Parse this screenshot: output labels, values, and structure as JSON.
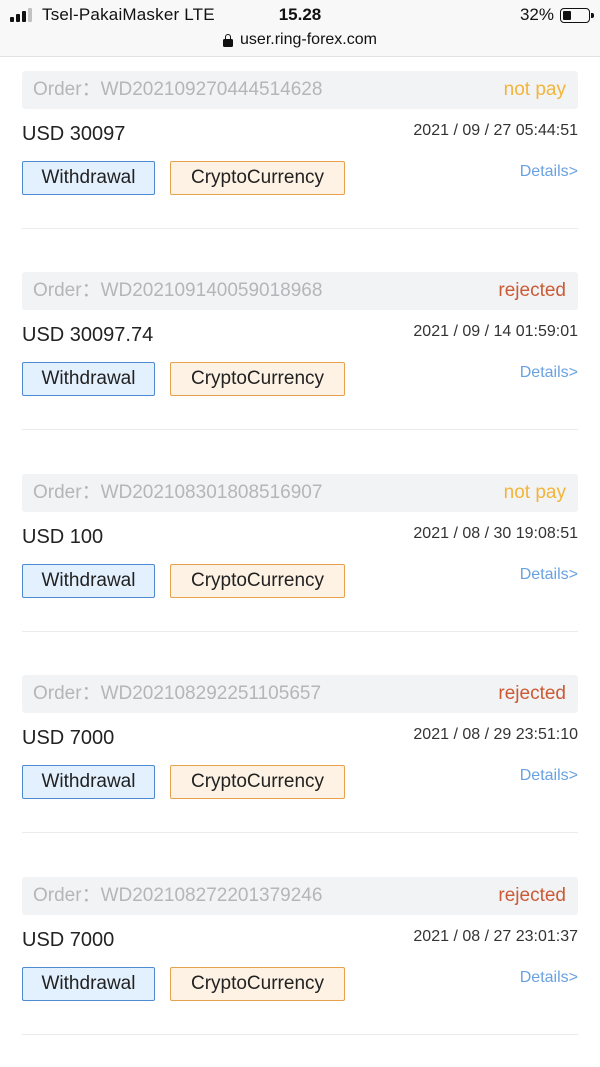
{
  "status_bar": {
    "carrier": "Tsel-PakaiMasker  LTE",
    "time": "15.28",
    "battery": "32%"
  },
  "browser": {
    "url": "user.ring-forex.com"
  },
  "colors": {
    "not_pay": "#f2b53a",
    "rejected": "#cc5a35",
    "link": "#6aa2e0"
  },
  "orders": [
    {
      "label": "Order：WD202109270444514628",
      "status": "not pay",
      "status_key": "not_pay",
      "amount": "USD 30097",
      "datetime": "2021 / 09 / 27 05:44:51",
      "type": "Withdrawal",
      "method": "CryptoCurrency",
      "details": "Details>"
    },
    {
      "label": "Order：WD202109140059018968",
      "status": "rejected",
      "status_key": "rejected",
      "amount": "USD 30097.74",
      "datetime": "2021 / 09 / 14 01:59:01",
      "type": "Withdrawal",
      "method": "CryptoCurrency",
      "details": "Details>"
    },
    {
      "label": "Order：WD202108301808516907",
      "status": "not pay",
      "status_key": "not_pay",
      "amount": "USD 100",
      "datetime": "2021 / 08 / 30 19:08:51",
      "type": "Withdrawal",
      "method": "CryptoCurrency",
      "details": "Details>"
    },
    {
      "label": "Order：WD202108292251105657",
      "status": "rejected",
      "status_key": "rejected",
      "amount": "USD 7000",
      "datetime": "2021 / 08 / 29 23:51:10",
      "type": "Withdrawal",
      "method": "CryptoCurrency",
      "details": "Details>"
    },
    {
      "label": "Order：WD202108272201379246",
      "status": "rejected",
      "status_key": "rejected",
      "amount": "USD 7000",
      "datetime": "2021 / 08 / 27 23:01:37",
      "type": "Withdrawal",
      "method": "CryptoCurrency",
      "details": "Details>"
    }
  ]
}
